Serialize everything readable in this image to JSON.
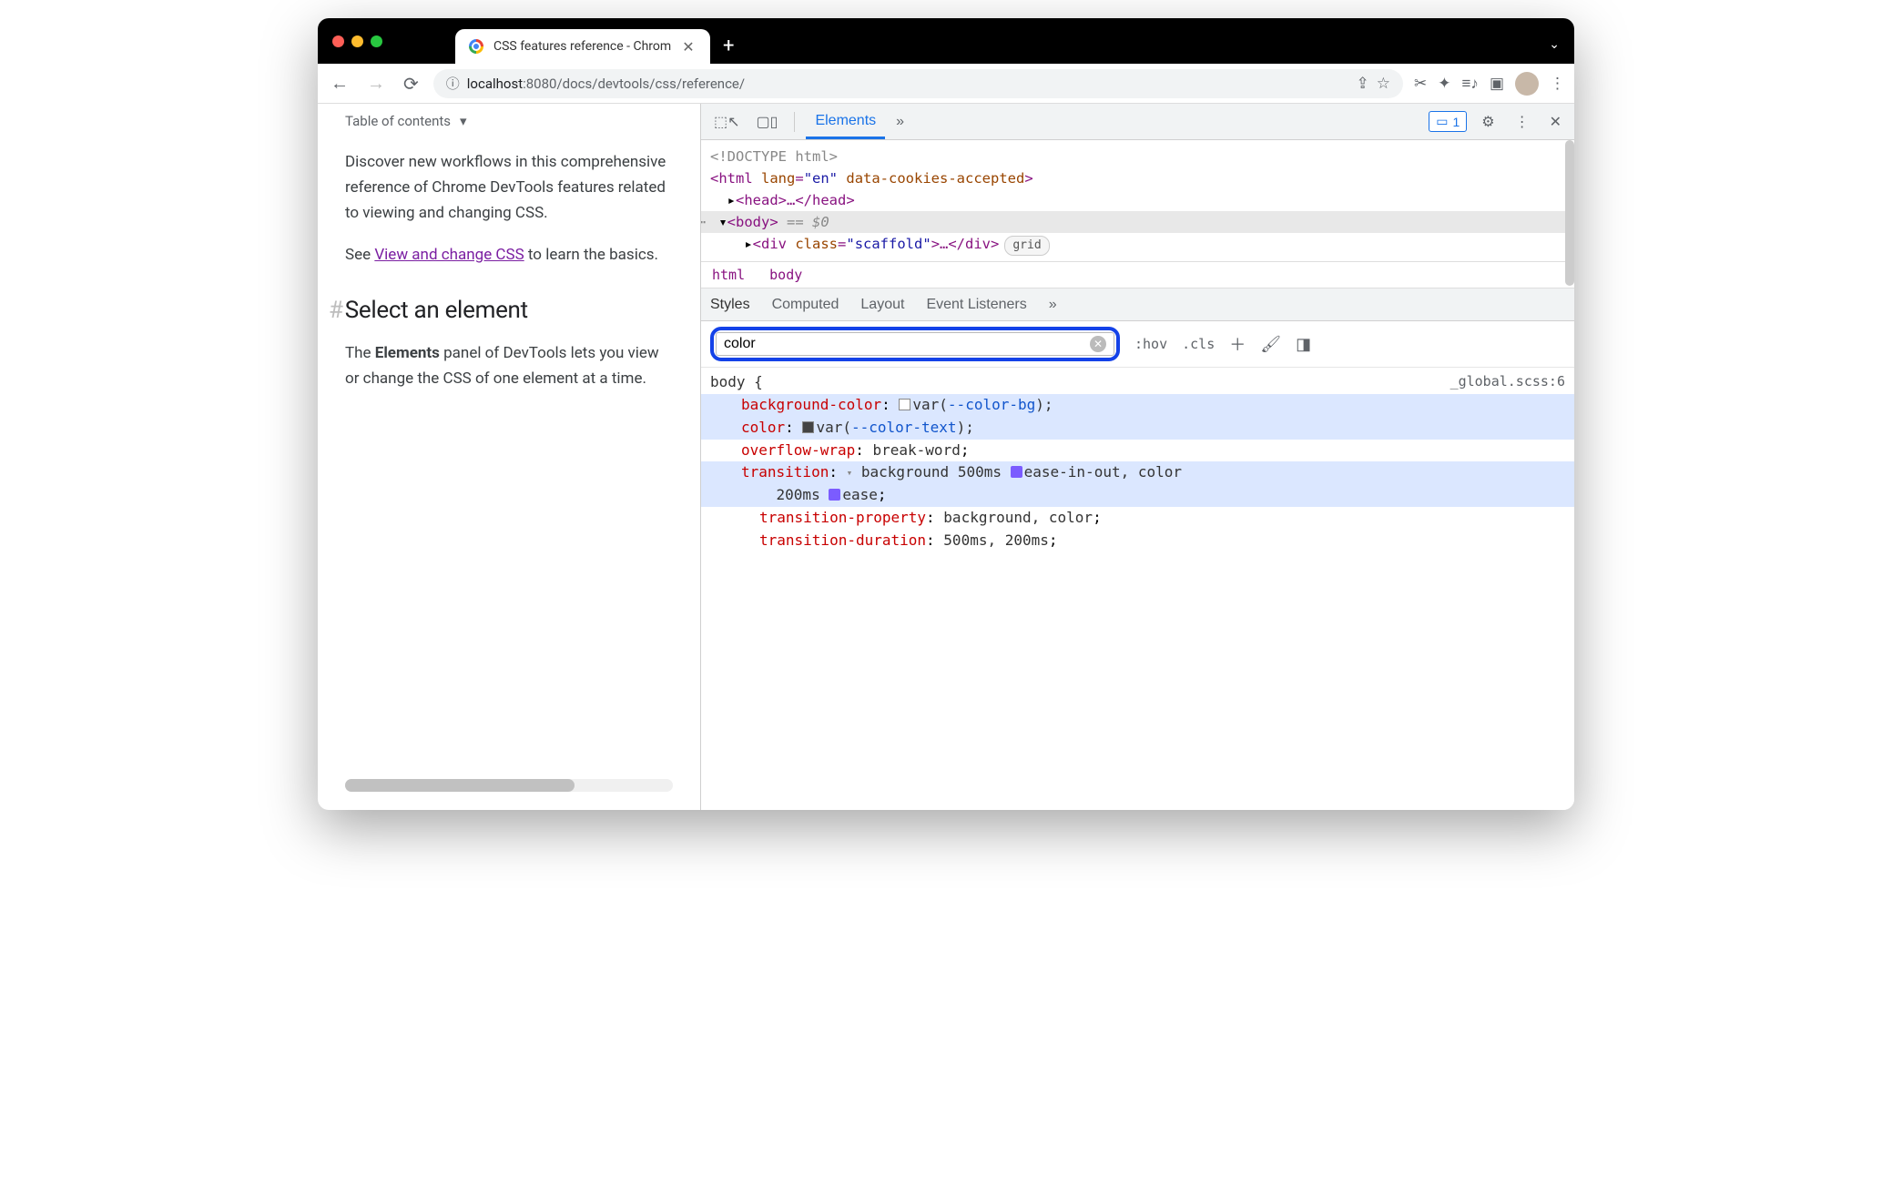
{
  "tab": {
    "title": "CSS features reference - Chrom"
  },
  "toolbar": {
    "url_prefix": "localhost",
    "url_port": ":8080",
    "url_path": "/docs/devtools/css/reference/"
  },
  "page": {
    "toc": "Table of contents",
    "intro": "Discover new workflows in this comprehensive reference of Chrome DevTools features related to viewing and changing CSS.",
    "see_prefix": "See ",
    "see_link": "View and change CSS",
    "see_suffix": " to learn the basics.",
    "h2": "Select an element",
    "p2_a": "The ",
    "p2_b": "Elements",
    "p2_c": " panel of DevTools lets you view or change the CSS of one element at a time."
  },
  "devtools": {
    "tabs": {
      "elements": "Elements"
    },
    "issues_count": "1",
    "dom": {
      "doctype": "<!DOCTYPE html>",
      "html_open": "<html",
      "html_attr1n": "lang",
      "html_attr1v": "\"en\"",
      "html_attr2n": "data-cookies-accepted",
      "html_close": ">",
      "head": "<head>…</head>",
      "body_open": "<body>",
      "body_eq": " == ",
      "body_dollar": "$0",
      "div_open": "<div ",
      "div_attr_n": "class",
      "div_attr_v": "\"scaffold\"",
      "div_rest": ">…</div>",
      "div_pill": "grid"
    },
    "crumbs": {
      "a": "html",
      "b": "body"
    },
    "subtabs": {
      "styles": "Styles",
      "computed": "Computed",
      "layout": "Layout",
      "events": "Event Listeners"
    },
    "filter": {
      "value": "color",
      "hov": ":hov",
      "cls": ".cls"
    },
    "rule": {
      "selector": "body {",
      "source": "_global.scss:6",
      "d1p": "background-color",
      "d1v_var": "--color-bg",
      "d2p": "color",
      "d2v_var": "--color-text",
      "d3p": "overflow-wrap",
      "d3v": "break-word",
      "d4p": "transition",
      "d4v_a": "background 500ms ",
      "d4v_b": "ease-in-out, color",
      "d4v_c": "200ms ",
      "d4v_d": "ease",
      "d5p": "transition-property",
      "d5v": "background, color",
      "d6p": "transition-duration",
      "d6v": "500ms, 200ms"
    }
  }
}
